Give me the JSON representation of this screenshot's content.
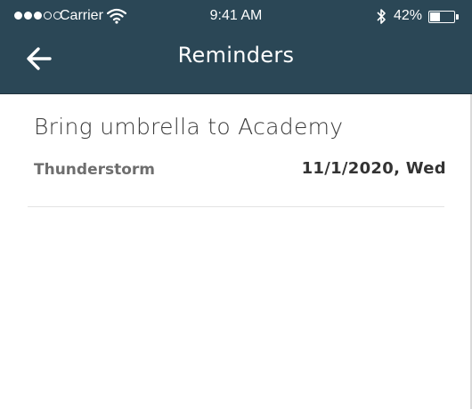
{
  "status_bar": {
    "carrier": "Carrier",
    "time": "9:41 AM",
    "battery_percent": "42%",
    "battery_level": 0.42,
    "signal_bars_filled": 3,
    "signal_bars_total": 5
  },
  "nav": {
    "title": "Reminders",
    "back_icon": "arrow-left-icon"
  },
  "reminders": [
    {
      "title": "Bring umbrella to Academy",
      "condition": "Thunderstorm",
      "date": "11/1/2020, Wed"
    }
  ],
  "colors": {
    "header_bg": "#2b4756",
    "text_primary": "#3a3a3a",
    "text_secondary": "#6e6e6e"
  }
}
